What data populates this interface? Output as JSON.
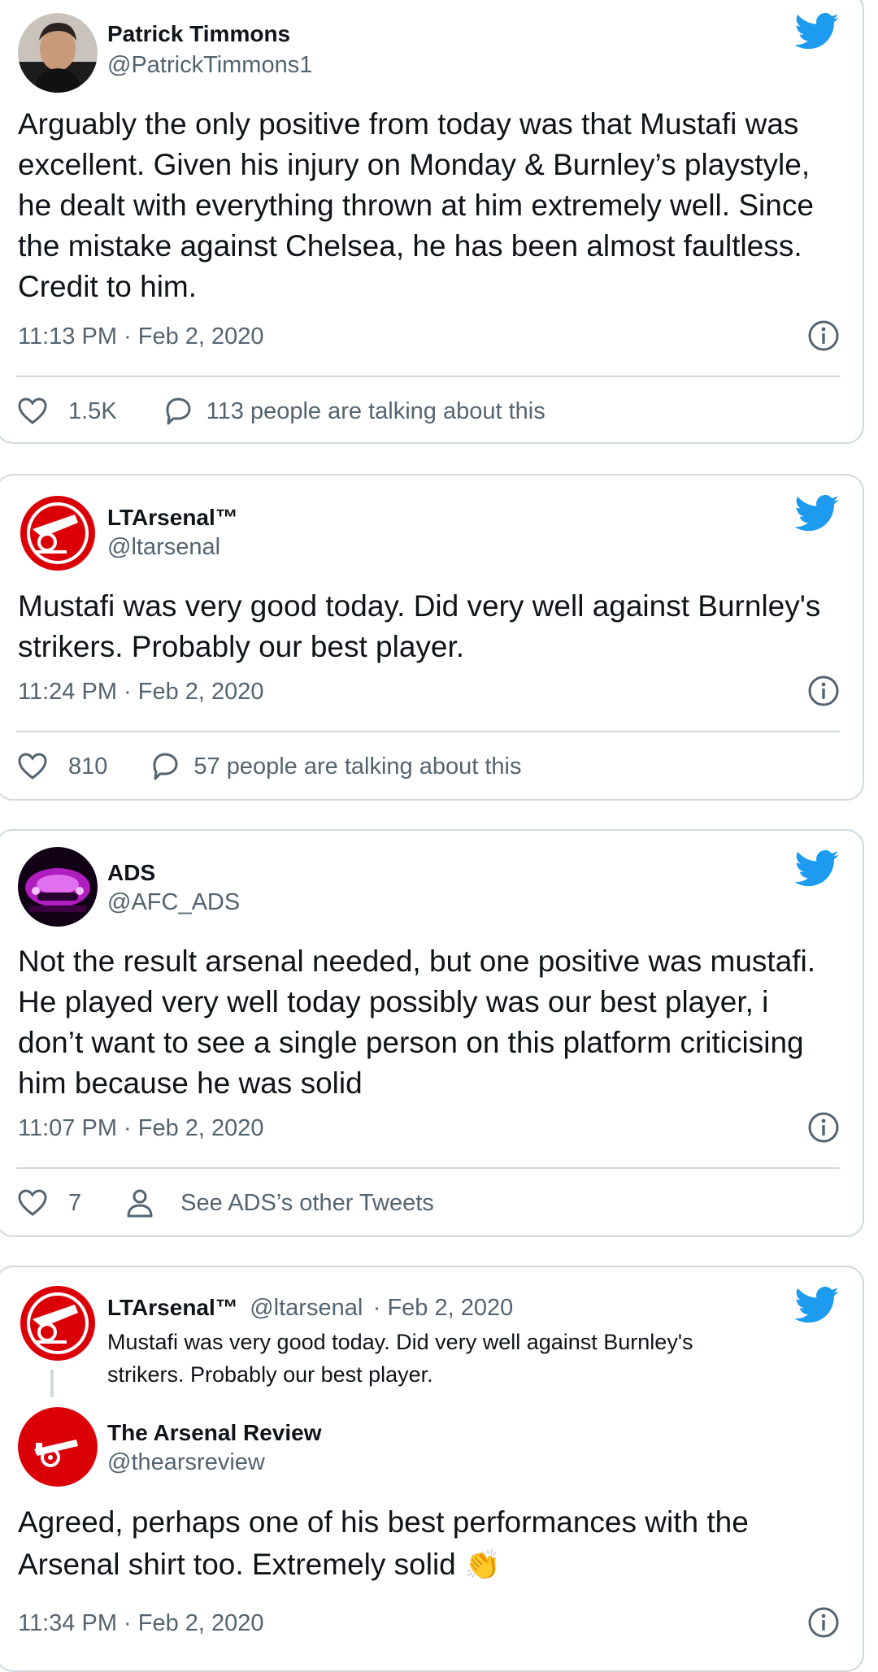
{
  "colors": {
    "twitter_blue": "#1d9bf0",
    "text": "#0f1419",
    "muted": "#536471",
    "border": "#cfd9de",
    "arsenal_red": "#db0007"
  },
  "tweets": [
    {
      "name": "Patrick Timmons",
      "handle": "@PatrickTimmons1",
      "text": "Arguably the only positive from today was that Mustafi was excellent. Given his injury on Monday & Burnley’s playstyle, he dealt with everything thrown at him extremely well. Since the mistake against Chelsea, he has been almost faultless. Credit to him.",
      "timestamp": "11:13 PM · Feb 2, 2020",
      "likes": "1.5K",
      "secondary_action": "113 people are talking about this",
      "avatar_icon": "profile-photo"
    },
    {
      "name": "LTArsenal™",
      "handle": "@ltarsenal",
      "text": "Mustafi was very good today. Did very well against Burnley's strikers. Probably our best player.",
      "timestamp": "11:24 PM · Feb 2, 2020",
      "likes": "810",
      "secondary_action": "57 people are talking about this",
      "avatar_icon": "cannon-logo"
    },
    {
      "name": "ADS",
      "handle": "@AFC_ADS",
      "text": "Not the result arsenal needed, but one positive was mustafi. He played very well today possibly was our best player, i don’t want to see a single person on this platform criticising him because he was solid",
      "timestamp": "11:07 PM · Feb 2, 2020",
      "likes": "7",
      "secondary_action": "See ADS’s other Tweets",
      "avatar_icon": "car-photo"
    },
    {
      "quoted": {
        "name": "LTArsenal™",
        "handle": "@ltarsenal",
        "date": "· Feb 2, 2020",
        "text": "Mustafi was very good today. Did very well against Burnley's strikers. Probably our best player."
      },
      "name": "The Arsenal Review",
      "handle": "@thearsreview",
      "text": "Agreed, perhaps one of his best performances with the Arsenal shirt too. Extremely solid",
      "emoji": "👏",
      "timestamp": "11:34 PM · Feb 2, 2020"
    }
  ]
}
